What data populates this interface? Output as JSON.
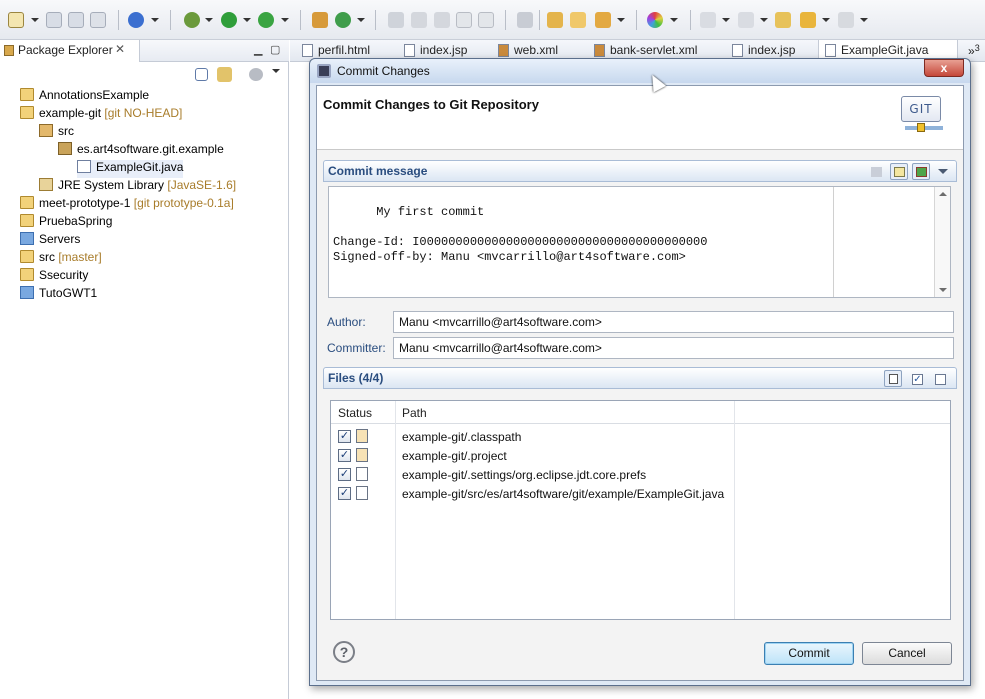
{
  "explorer": {
    "tab_title": "Package Explorer",
    "tree": [
      {
        "label": "AnnotationsExample",
        "decor": "",
        "level": 0,
        "icon": "project-icon"
      },
      {
        "label": "example-git",
        "decor": "[git NO-HEAD]",
        "level": 0,
        "icon": "project-icon"
      },
      {
        "label": "src",
        "decor": "",
        "level": 1,
        "icon": "source-folder-icon"
      },
      {
        "label": "es.art4software.git.example",
        "decor": "",
        "level": 2,
        "icon": "package-icon"
      },
      {
        "label": "ExampleGit.java",
        "decor": "",
        "level": 3,
        "icon": "java-file-icon"
      },
      {
        "label": "JRE System Library",
        "decor": "[JavaSE-1.6]",
        "level": 1,
        "icon": "library-icon"
      },
      {
        "label": "meet-prototype-1",
        "decor": "[git prototype-0.1a]",
        "level": 0,
        "icon": "project-icon"
      },
      {
        "label": "PruebaSpring",
        "decor": "",
        "level": 0,
        "icon": "project-icon"
      },
      {
        "label": "Servers",
        "decor": "",
        "level": 0,
        "icon": "folder-icon"
      },
      {
        "label": "src",
        "decor": "[master]",
        "level": 0,
        "icon": "project-icon"
      },
      {
        "label": "Ssecurity",
        "decor": "",
        "level": 0,
        "icon": "project-icon"
      },
      {
        "label": "TutoGWT1",
        "decor": "",
        "level": 0,
        "icon": "folder-icon"
      }
    ]
  },
  "editor_tabs": [
    "perfil.html",
    "index.jsp",
    "web.xml",
    "bank-servlet.xml",
    "index.jsp",
    "ExampleGit.java"
  ],
  "editor_tabs_overflow": "3",
  "dialog": {
    "window_title": "Commit Changes",
    "close_label": "x",
    "banner_title": "Commit Changes to Git Repository",
    "logo_text": "GIT",
    "commit_section_label": "Commit message",
    "commit_message": "My first commit\n\nChange-Id: I0000000000000000000000000000000000000000\nSigned-off-by: Manu <mvcarrillo@art4software.com>",
    "author_label": "Author:",
    "author_value": "Manu <mvcarrillo@art4software.com>",
    "committer_label": "Committer:",
    "committer_value": "Manu <mvcarrillo@art4software.com>",
    "files_section_label": "Files (4/4)",
    "columns": {
      "status": "Status",
      "path": "Path"
    },
    "files": [
      {
        "checked": true,
        "path": "example-git/.classpath",
        "icon": "xml-file-icon"
      },
      {
        "checked": true,
        "path": "example-git/.project",
        "icon": "xml-file-icon"
      },
      {
        "checked": true,
        "path": "example-git/.settings/org.eclipse.jdt.core.prefs",
        "icon": "text-file-icon"
      },
      {
        "checked": true,
        "path": "example-git/src/es/art4software/git/example/ExampleGit.java",
        "icon": "java-file-icon"
      }
    ],
    "help_label": "?",
    "commit_button": "Commit",
    "cancel_button": "Cancel"
  }
}
